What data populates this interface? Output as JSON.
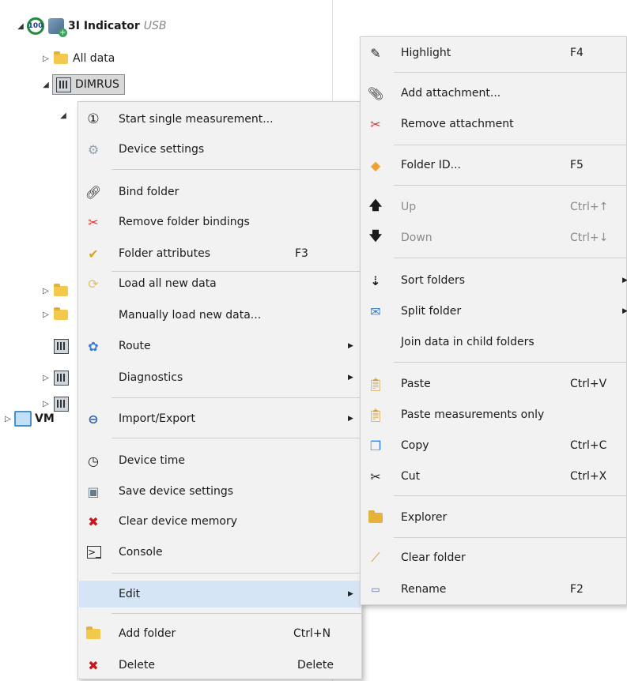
{
  "tree": {
    "root": {
      "badge": "100",
      "name": "3I Indicator",
      "suffix": "USB"
    },
    "all_data": "All data",
    "dimrus": "DIMRUS",
    "vm": "VM"
  },
  "context_menu": {
    "items": [
      {
        "label": "Start single measurement...",
        "key": "",
        "icon": "number-one-icon"
      },
      {
        "label": "Device settings",
        "key": "",
        "icon": "gears-icon"
      },
      {
        "label": "Bind folder",
        "key": "",
        "icon": "chain-link-icon"
      },
      {
        "label": "Remove folder bindings",
        "key": "",
        "icon": "broken-link-icon"
      },
      {
        "label": "Folder attributes",
        "key": "F3",
        "icon": "checkmark-pen-icon"
      },
      {
        "label": "Load all new data",
        "key": "",
        "icon": "refresh-icon"
      },
      {
        "label": "Manually load new data...",
        "key": "",
        "icon": ""
      },
      {
        "label": "Route",
        "key": "",
        "icon": "route-icon"
      },
      {
        "label": "Diagnostics",
        "key": "",
        "icon": ""
      },
      {
        "label": "Import/Export",
        "key": "",
        "icon": "import-export-icon"
      },
      {
        "label": "Device time",
        "key": "",
        "icon": "clock-icon"
      },
      {
        "label": "Save device settings",
        "key": "",
        "icon": "floppy-disk-icon"
      },
      {
        "label": "Clear device memory",
        "key": "",
        "icon": "red-x-icon"
      },
      {
        "label": "Console",
        "key": "",
        "icon": "console-icon"
      },
      {
        "label": "Edit",
        "key": "",
        "icon": ""
      },
      {
        "label": "Add folder",
        "key": "Ctrl+N",
        "icon": "add-folder-icon"
      },
      {
        "label": "Delete",
        "key": "Delete",
        "icon": "red-x-icon"
      }
    ]
  },
  "edit_menu": {
    "items": [
      {
        "label": "Highlight",
        "key": "F4",
        "icon": "highlighter-icon"
      },
      {
        "label": "Add attachment...",
        "key": "",
        "icon": "paperclip-icon"
      },
      {
        "label": "Remove attachment",
        "key": "",
        "icon": "remove-paperclip-icon"
      },
      {
        "label": "Folder ID...",
        "key": "F5",
        "icon": "tag-icon"
      },
      {
        "label": "Up",
        "key": "Ctrl+↑",
        "icon": "arrow-up-icon"
      },
      {
        "label": "Down",
        "key": "Ctrl+↓",
        "icon": "arrow-down-icon"
      },
      {
        "label": "Sort folders",
        "key": "",
        "icon": "sort-icon"
      },
      {
        "label": "Split folder",
        "key": "",
        "icon": "split-icon"
      },
      {
        "label": "Join data in child folders",
        "key": "",
        "icon": ""
      },
      {
        "label": "Paste",
        "key": "Ctrl+V",
        "icon": "clipboard-paste-icon"
      },
      {
        "label": "Paste measurements only",
        "key": "",
        "icon": "clipboard-paste-icon"
      },
      {
        "label": "Copy",
        "key": "Ctrl+C",
        "icon": "copy-icon"
      },
      {
        "label": "Cut",
        "key": "Ctrl+X",
        "icon": "scissors-icon"
      },
      {
        "label": "Explorer",
        "key": "",
        "icon": "explorer-folder-icon"
      },
      {
        "label": "Clear folder",
        "key": "",
        "icon": "broom-icon"
      },
      {
        "label": "Rename",
        "key": "F2",
        "icon": "rename-icon"
      }
    ]
  }
}
